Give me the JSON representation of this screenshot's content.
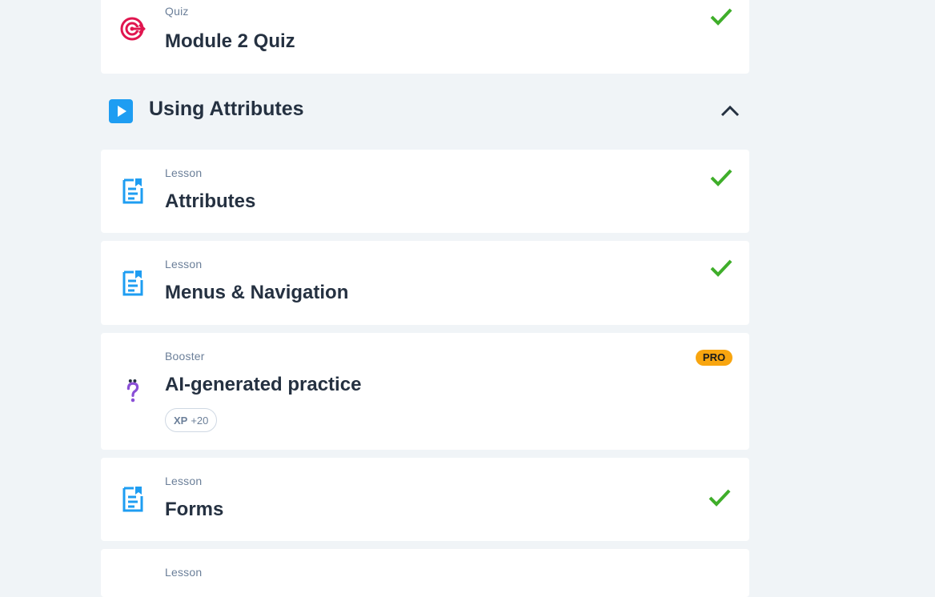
{
  "items_top": {
    "quiz": {
      "type": "Quiz",
      "title": "Module 2 Quiz",
      "completed": true
    }
  },
  "section": {
    "title": "Using Attributes",
    "expanded": true
  },
  "lessons": [
    {
      "type": "Lesson",
      "title": "Attributes",
      "completed": true
    },
    {
      "type": "Lesson",
      "title": "Menus & Navigation",
      "completed": true
    }
  ],
  "booster": {
    "type": "Booster",
    "title": "AI-generated practice",
    "badge": "PRO",
    "xp_label": "XP",
    "xp_value": "+20"
  },
  "lesson_forms": {
    "type": "Lesson",
    "title": "Forms",
    "completed": true
  },
  "lesson_partial": {
    "type": "Lesson"
  },
  "colors": {
    "check": "#3fae2a",
    "accent": "#1e9df2",
    "quiz_icon": "#e0164f",
    "booster_icon": "#8a4fd6",
    "pro_badge": "#f8a50f"
  }
}
